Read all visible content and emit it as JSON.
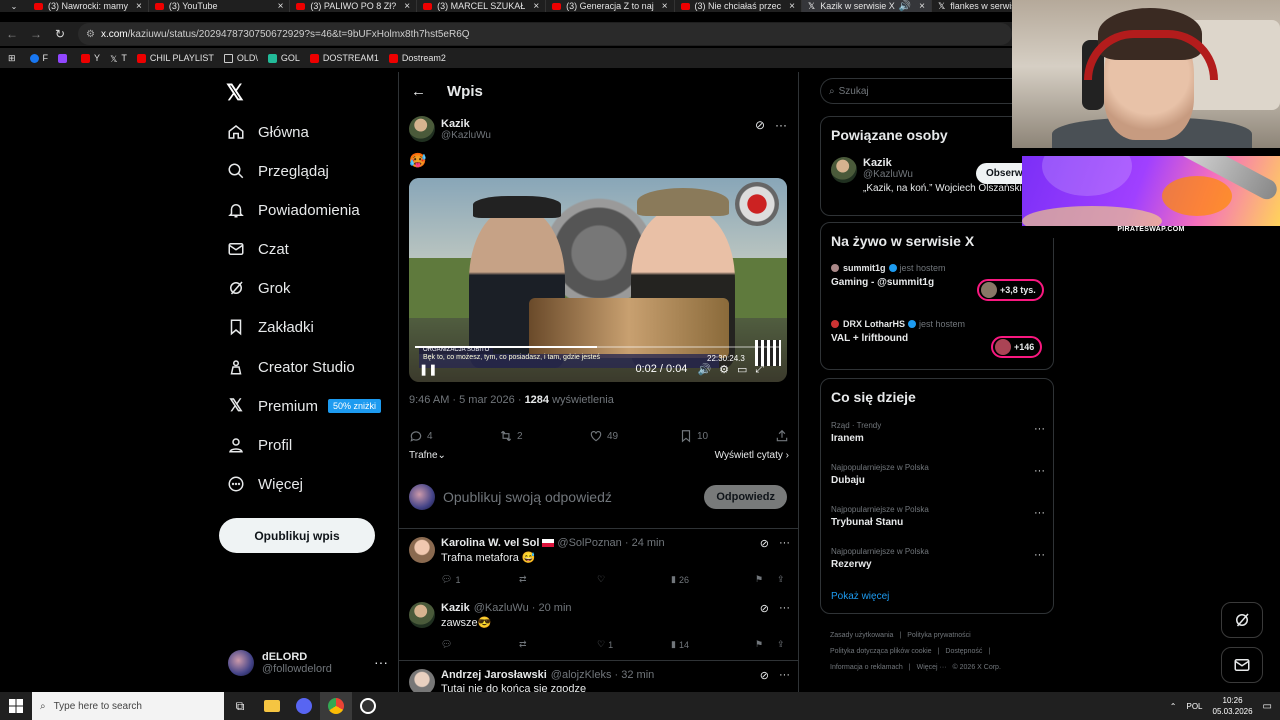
{
  "browser": {
    "tabs": [
      {
        "label": "(3) Nawrocki: mamy"
      },
      {
        "label": "(3) YouTube"
      },
      {
        "label": "(3) PALIWO PO 8 Zł?"
      },
      {
        "label": "(3) MARCEL SZUKAŁ"
      },
      {
        "label": "(3) Generacja Z to naj"
      },
      {
        "label": "(3) Nie chciałaś przec"
      },
      {
        "label": "Kazik w serwisie X"
      },
      {
        "label": "flankes w serwisie X"
      }
    ],
    "url_host": "x.com",
    "url_path": "/kaziuwu/status/2029478730750672929?s=46&t=9bUFxHolmx8th7hst5eR6Q",
    "bookmarks": [
      "F",
      "Y",
      "T",
      "CHIL PLAYLIST",
      "OLD\\",
      "GOL",
      "DOSTREAM1",
      "Dostream2"
    ]
  },
  "sidebar": {
    "items": [
      {
        "label": "Główna",
        "icon": "home-icon"
      },
      {
        "label": "Przeglądaj",
        "icon": "search-icon"
      },
      {
        "label": "Powiadomienia",
        "icon": "bell-icon"
      },
      {
        "label": "Czat",
        "icon": "mail-icon"
      },
      {
        "label": "Grok",
        "icon": "grok-icon"
      },
      {
        "label": "Zakładki",
        "icon": "bookmark-icon"
      },
      {
        "label": "Creator Studio",
        "icon": "creator-icon"
      },
      {
        "label": "Premium",
        "icon": "x-icon",
        "badge": "50% zniżki"
      },
      {
        "label": "Profil",
        "icon": "person-icon"
      },
      {
        "label": "Więcej",
        "icon": "more-circle-icon"
      }
    ],
    "post_button": "Opublikuj wpis",
    "account": {
      "name": "dELORD",
      "handle": "@followdelord"
    }
  },
  "main": {
    "title": "Wpis",
    "tweet": {
      "name": "Kazik",
      "handle": "@KazluWu",
      "emoji": "🥵",
      "video": {
        "time": "0:02 / 0:04",
        "progress": 0.5,
        "ticker": "Bęk to, co możesz, tym, co posiadasz, i tam, gdzie jesteś",
        "chip": "ORGANIZACJA SUBITO",
        "clock": "22:30:24.3"
      },
      "time": "9:46 AM · 5 mar 2026 · ",
      "views_count": "1284",
      "views_label": " wyświetlenia",
      "stats": {
        "replies": "4",
        "reposts": "2",
        "likes": "49",
        "bookmarks": "10"
      }
    },
    "sort_label": "Trafne",
    "quotes_label": "Wyświetl cytaty ›",
    "reply_placeholder": "Opublikuj swoją odpowiedź",
    "reply_button": "Odpowiedz",
    "replies": [
      {
        "name": "Karolina W. vel Sol",
        "handle": "@SolPoznan · 24 min",
        "text": "Trafna metafora 😅",
        "replies": "1",
        "reposts": "",
        "likes": "",
        "views": "26"
      },
      {
        "name": "Kazik",
        "handle": "@KazluWu · 20 min",
        "text": "zawsze😎",
        "replies": "",
        "reposts": "",
        "likes": "1",
        "views": "14"
      },
      {
        "name": "Andrzej Jarosławski",
        "handle": "@alojzKleks · 32 min",
        "text": "Tutaj nie do końca się zgodzę",
        "replies": "",
        "reposts": "",
        "likes": "",
        "views": ""
      }
    ]
  },
  "right": {
    "search_placeholder": "Szukaj",
    "related": {
      "title": "Powiązane osoby",
      "name": "Kazik",
      "handle": "@KazluWu",
      "bio": "„Kazik, na koń.” Wojciech Olszański",
      "follow": "Obserwuj"
    },
    "live": {
      "title": "Na żywo w serwisie X",
      "items": [
        {
          "host": "summit1g",
          "host_suffix": "jest hostem",
          "title": "Gaming - @summit1g",
          "count": "+3,8 tys."
        },
        {
          "host": "DRX LotharHS",
          "host_suffix": "jest hostem",
          "title": "VAL + lriftbound",
          "count": "+146"
        }
      ]
    },
    "trends": {
      "title": "Co się dzieje",
      "items": [
        {
          "context": "Rząd · Trendy",
          "name": "Iranem"
        },
        {
          "context": "Najpopularniejsze w Polska",
          "name": "Dubaju"
        },
        {
          "context": "Najpopularniejsze w Polska",
          "name": "Trybunał Stanu"
        },
        {
          "context": "Najpopularniejsze w Polska",
          "name": "Rezerwy"
        }
      ],
      "show_more": "Pokaż więcej"
    },
    "footer": [
      "Zasady użytkowania",
      "|",
      "Polityka prywatności",
      "|",
      "Polityka dotycząca plików cookie",
      "|",
      "Dostępność",
      "|",
      "Informacja o reklamach",
      "|",
      "Więcej ···",
      "© 2026 X Corp."
    ]
  },
  "overlay": {
    "ad_caption": "PIRATESWAP.COM"
  },
  "taskbar": {
    "search_placeholder": "Type here to search",
    "lang": "POL",
    "time": "10:26",
    "date": "05.03.2026"
  },
  "colors": {
    "accent": "#1d9bf0",
    "live": "#f91880",
    "background": "#000000"
  }
}
